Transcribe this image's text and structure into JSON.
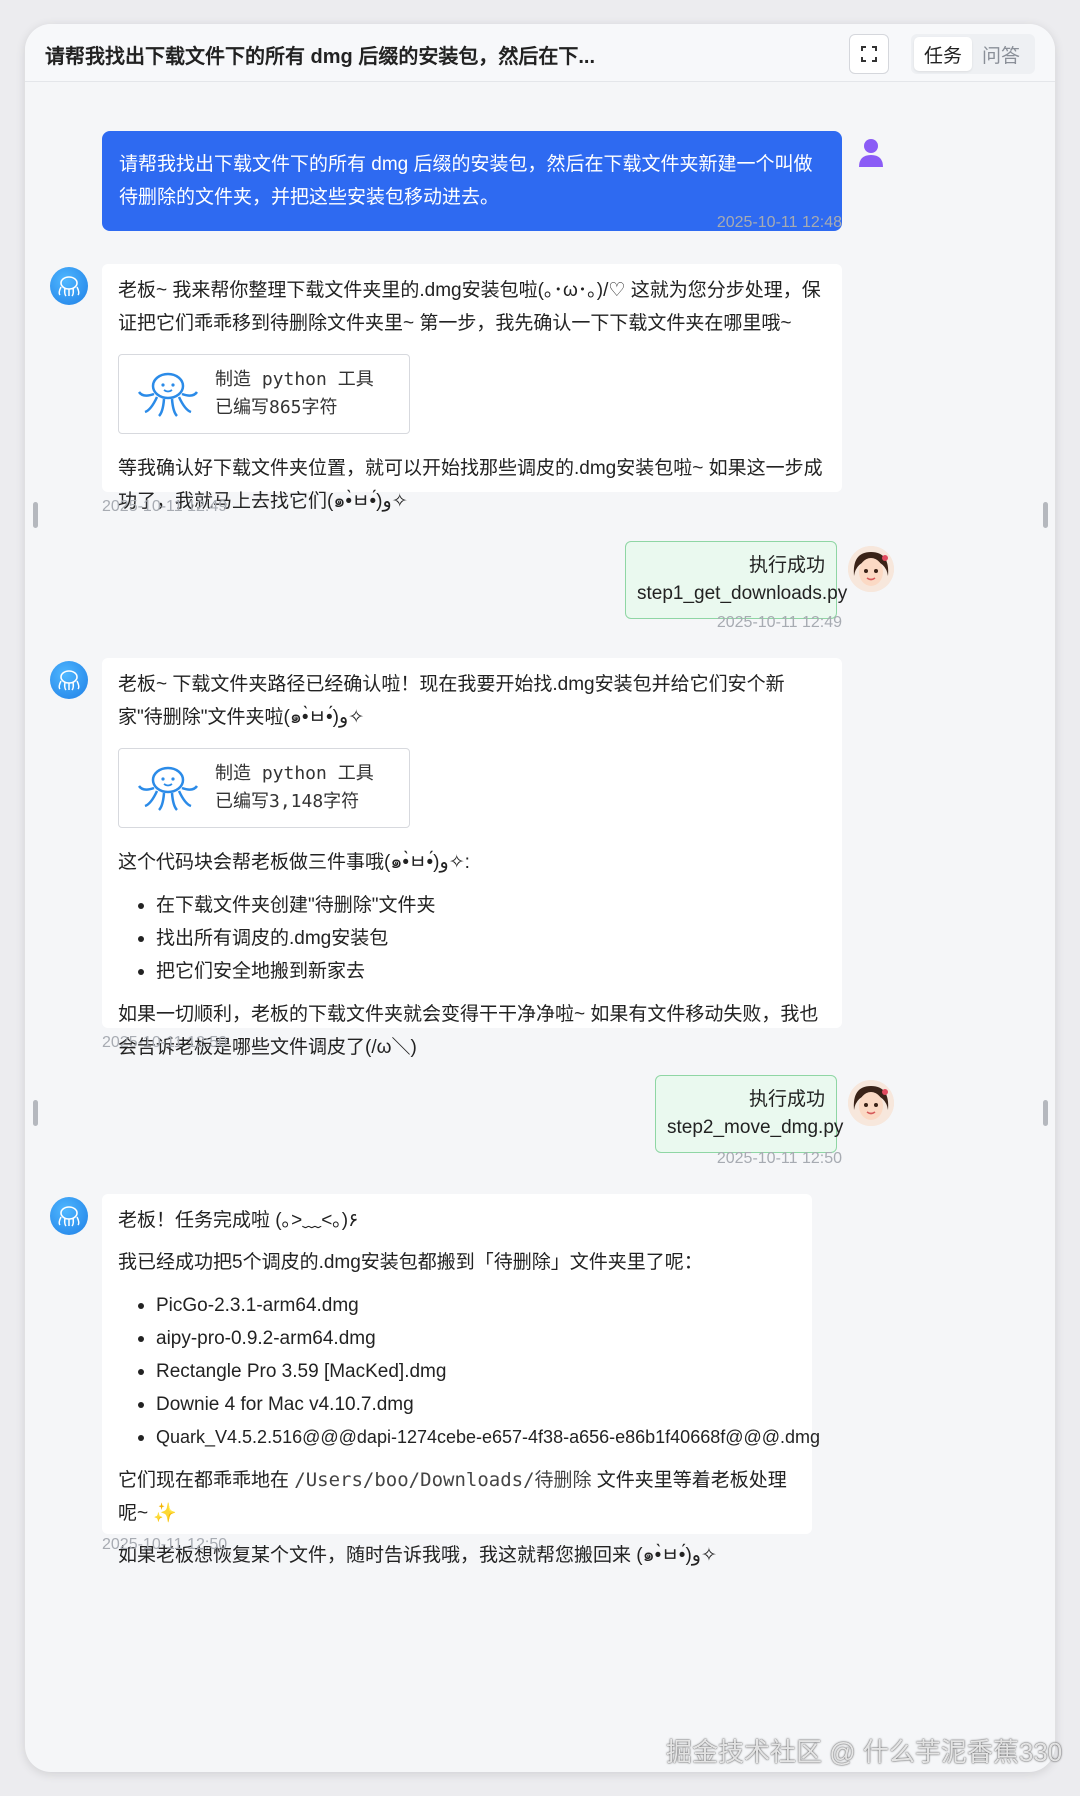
{
  "header": {
    "title": "请帮我找出下载文件下的所有 dmg 后缀的安装包，然后在下...",
    "tabs": [
      {
        "label": "任务",
        "active": true
      },
      {
        "label": "问答",
        "active": false
      }
    ]
  },
  "messages": {
    "m1": {
      "text": "请帮我找出下载文件下的所有 dmg 后缀的安装包，然后在下载文件夹新建一个叫做待删除的文件夹，并把这些安装包移动进去。",
      "time": "2025-10-11 12:48"
    },
    "m2": {
      "p1": "老板~ 我来帮你整理下载文件夹里的.dmg安装包啦(｡･ω･｡)/♡ 这就为您分步处理，保证把它们乖乖移到待删除文件夹里~ 第一步，我先确认一下下载文件夹在哪里哦~",
      "tool_title": "制造 python 工具",
      "tool_sub": "已编写865字符",
      "p2": "等我确认好下载文件夹位置，就可以开始找那些调皮的.dmg安装包啦~ 如果这一步成功了，我就马上去找它们(๑•̀ㅂ•́)و✧",
      "time": "2025-10-11 12:49"
    },
    "m3": {
      "status": "执行成功",
      "file": "step1_get_downloads.py",
      "time": "2025-10-11 12:49"
    },
    "m4": {
      "p1": "老板~ 下载文件夹路径已经确认啦！现在我要开始找.dmg安装包并给它们安个新家\"待删除\"文件夹啦(๑•̀ㅂ•́)و✧",
      "tool_title": "制造 python 工具",
      "tool_sub": "已编写3,148字符",
      "p2": "这个代码块会帮老板做三件事哦(๑•̀ㅂ•́)و✧:",
      "items": [
        "在下载文件夹创建\"待删除\"文件夹",
        "找出所有调皮的.dmg安装包",
        "把它们安全地搬到新家去"
      ],
      "p3": "如果一切顺利，老板的下载文件夹就会变得干干净净啦~ 如果有文件移动失败，我也会告诉老板是哪些文件调皮了(/ω＼)",
      "time": "2025-10-11 12:50"
    },
    "m5": {
      "status": "执行成功",
      "file": "step2_move_dmg.py",
      "time": "2025-10-11 12:50"
    },
    "m6": {
      "p1": "老板！任务完成啦 (｡>﹏<｡)۶",
      "p2": "我已经成功把5个调皮的.dmg安装包都搬到「待删除」文件夹里了呢：",
      "files": [
        "PicGo-2.3.1-arm64.dmg",
        "aipy-pro-0.9.2-arm64.dmg",
        "Rectangle Pro 3.59 [MacKed].dmg",
        "Downie 4 for Mac v4.10.7.dmg",
        "Quark_V4.5.2.516@@@dapi-1274cebe-e657-4f38-a656-e86b1f40668f@@@.dmg"
      ],
      "p3_prefix": "它们现在都乖乖地在",
      "p3_path": "/Users/boo/Downloads/待删除",
      "p3_suffix": "文件夹里等着老板处理呢~ ✨",
      "p4": "如果老板想恢复某个文件，随时告诉我哦，我这就帮您搬回来 (๑•̀ㅂ•́)و✧",
      "time": "2025-10-11 12:50"
    }
  },
  "watermark": "掘金技术社区 @ 什么芋泥香蕉330",
  "colors": {
    "accent": "#2e6af1",
    "success_bg": "#eaf9ef",
    "success_border": "#8fd6a4"
  }
}
